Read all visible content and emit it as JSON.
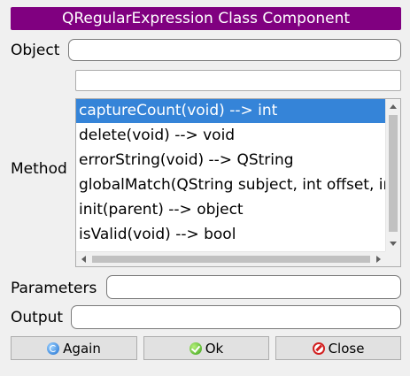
{
  "window": {
    "title": "QRegularExpression Class Component"
  },
  "labels": {
    "object": "Object",
    "method": "Method",
    "parameters": "Parameters",
    "output": "Output"
  },
  "fields": {
    "object_value": "",
    "method_filter_value": "",
    "parameters_value": "",
    "output_value": ""
  },
  "methods": {
    "selected_index": 0,
    "items": [
      "captureCount(void) --> int",
      "delete(void) --> void",
      "errorString(void) --> QString",
      "globalMatch(QString subject, int offset, int matchType, int matchOptions)",
      "init(parent) --> object",
      "isValid(void) --> bool"
    ]
  },
  "buttons": {
    "again": {
      "label": "Again",
      "icon": "refresh-icon"
    },
    "ok": {
      "label": "Ok",
      "icon": "check-icon"
    },
    "close": {
      "label": "Close",
      "icon": "no-entry-icon"
    }
  },
  "colors": {
    "title_bg": "#800080",
    "selection": "#3584d8"
  }
}
